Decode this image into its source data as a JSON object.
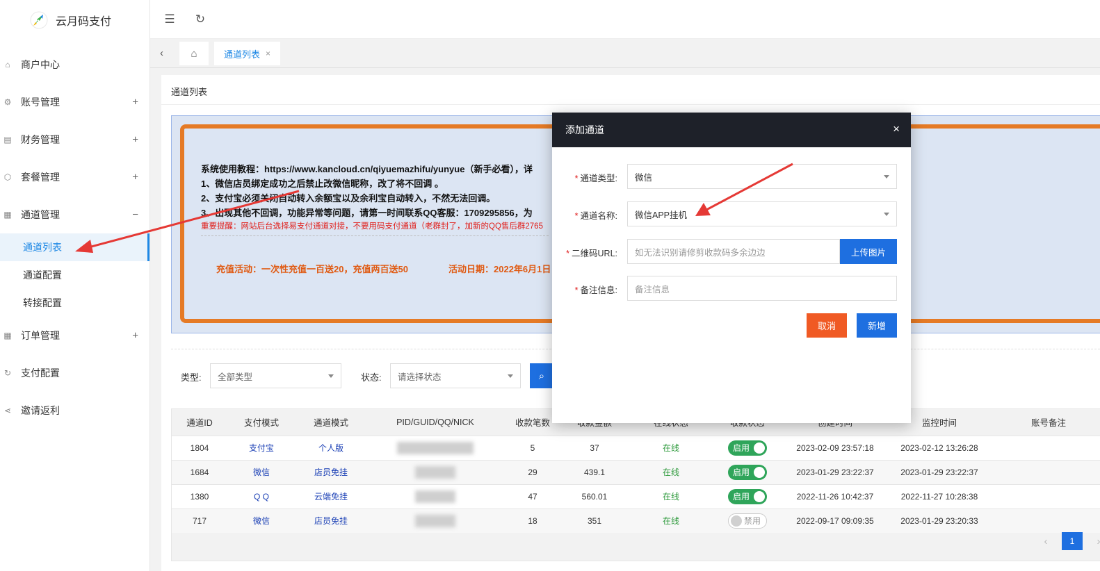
{
  "app": {
    "title": "云月码支付",
    "logo_icon": "rocket-icon"
  },
  "sidebar": {
    "items": [
      {
        "label": "商户中心",
        "icon": "home-icon",
        "toggle": ""
      },
      {
        "label": "账号管理",
        "icon": "gear-icon",
        "toggle": "+"
      },
      {
        "label": "财务管理",
        "icon": "finance-icon",
        "toggle": "+"
      },
      {
        "label": "套餐管理",
        "icon": "package-icon",
        "toggle": "+"
      },
      {
        "label": "通道管理",
        "icon": "grid-icon",
        "toggle": "−"
      },
      {
        "label": "订单管理",
        "icon": "grid-icon",
        "toggle": "+"
      },
      {
        "label": "支付配置",
        "icon": "refresh-icon",
        "toggle": ""
      },
      {
        "label": "邀请返利",
        "icon": "share-icon",
        "toggle": ""
      }
    ],
    "sub_items": [
      "通道列表",
      "通道配置",
      "转接配置"
    ]
  },
  "header": {
    "menu_icon": "menu-fold-icon",
    "refresh_icon": "refresh-icon"
  },
  "tabs": {
    "active_label": "通道列表",
    "close": "×"
  },
  "page": {
    "breadcrumb": "通道列表",
    "notice": {
      "line1": "系统使用教程：https://www.kancloud.cn/qiyuemazhifu/yunyue（新手必看），详",
      "line2": "1、微信店员绑定成功之后禁止改微信昵称，改了将不回调 。",
      "line3": "2、支付宝必须关闭自动转入余额宝以及余利宝自动转入，不然无法回调。",
      "line4": "3、出现其他不回调，功能异常等问题，请第一时间联系QQ客服：1709295856，为",
      "warning": "重要提醒：网站后台选择易支付通道对接，不要用码支付通道（老群封了，加新的QQ售后群2765",
      "promo1": "充值活动：一次性充值一百送20，充值两百送50",
      "promo2": "活动日期：2022年6月1日"
    },
    "filter": {
      "type_label": "类型:",
      "type_value": "全部类型",
      "status_label": "状态:",
      "status_value": "请选择状态",
      "search_icon": "search-icon"
    },
    "table": {
      "headers": [
        "通道ID",
        "支付模式",
        "通道模式",
        "PID/GUID/QQ/NICK",
        "收款笔数",
        "收款金额",
        "在线状态",
        "收款状态",
        "创建时间",
        "监控时间",
        "账号备注"
      ],
      "rows": [
        {
          "id": "1804",
          "pay_mode": "支付宝",
          "channel_mode": "个人版",
          "count": "5",
          "amount": "37",
          "online": "在线",
          "status": "启用",
          "status_on": true,
          "created": "2023-02-09 23:57:18",
          "monitor": "2023-02-12 13:26:28",
          "remark": ""
        },
        {
          "id": "1684",
          "pay_mode": "微信",
          "channel_mode": "店员免挂",
          "count": "29",
          "amount": "439.1",
          "online": "在线",
          "status": "启用",
          "status_on": true,
          "created": "2023-01-29 23:22:37",
          "monitor": "2023-01-29 23:22:37",
          "remark": ""
        },
        {
          "id": "1380",
          "pay_mode": "Q Q",
          "channel_mode": "云端免挂",
          "count": "47",
          "amount": "560.01",
          "online": "在线",
          "status": "启用",
          "status_on": true,
          "created": "2022-11-26 10:42:37",
          "monitor": "2022-11-27 10:28:38",
          "remark": ""
        },
        {
          "id": "717",
          "pay_mode": "微信",
          "channel_mode": "店员免挂",
          "count": "18",
          "amount": "351",
          "online": "在线",
          "status": "禁用",
          "status_on": false,
          "created": "2022-09-17 09:09:35",
          "monitor": "2023-01-29 23:20:33",
          "remark": ""
        }
      ]
    },
    "pager": {
      "current": "1",
      "prev": "‹",
      "next": "›"
    }
  },
  "modal": {
    "title": "添加通道",
    "close": "×",
    "fields": {
      "type_label": "通道类型:",
      "type_value": "微信",
      "name_label": "通道名称:",
      "name_value": "微信APP挂机",
      "qr_label": "二维码URL:",
      "qr_placeholder": "如无法识别请修剪收款码多余边边",
      "upload_label": "上传图片",
      "remark_label": "备注信息:",
      "remark_placeholder": "备注信息"
    },
    "cancel_label": "取消",
    "add_label": "新增"
  },
  "colors": {
    "accent": "#1e6fe0",
    "notice_border": "#e57a25",
    "annotation_arrow": "#e53935"
  }
}
